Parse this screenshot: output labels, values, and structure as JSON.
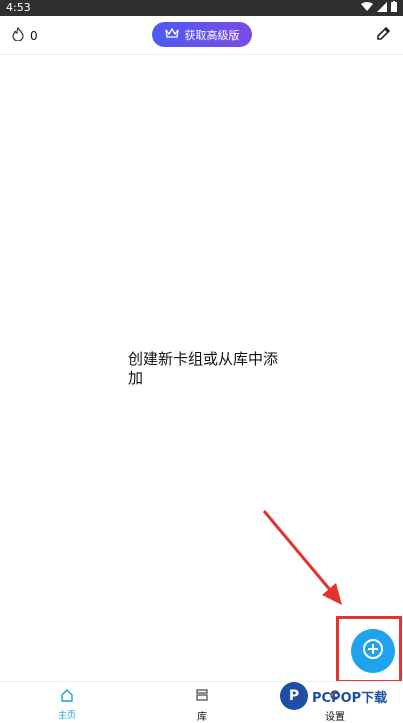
{
  "status_bar": {
    "time": "4:53"
  },
  "top_bar": {
    "streak_count": "0",
    "premium_label": "获取高级版"
  },
  "main": {
    "empty_message": "创建新卡组或从库中添加"
  },
  "bottom_nav": {
    "items": [
      {
        "label": "主页",
        "icon": "home-icon",
        "active": true
      },
      {
        "label": "库",
        "icon": "library-icon",
        "active": false
      },
      {
        "label": "设置",
        "icon": "settings-icon",
        "active": false
      }
    ]
  },
  "watermark": {
    "text": "PCPOP下载"
  },
  "colors": {
    "accent": "#1fa3ec",
    "premium_start": "#4a5cf0",
    "premium_end": "#7c4ae8",
    "highlight": "#e4332c"
  }
}
